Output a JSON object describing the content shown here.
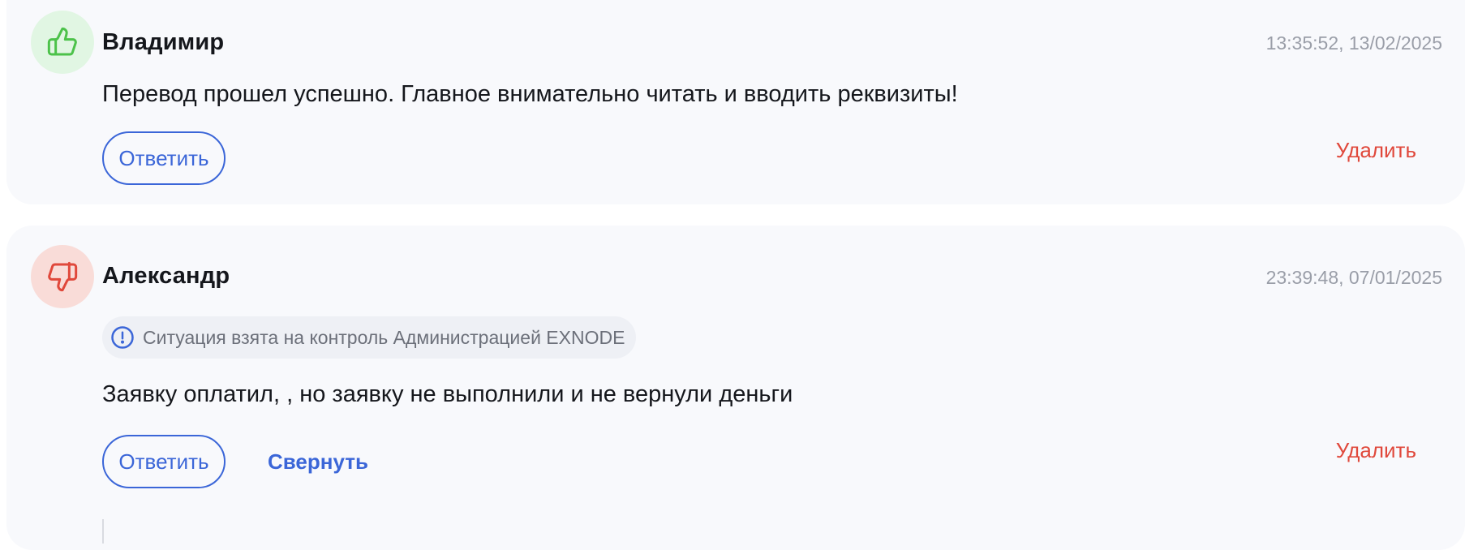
{
  "reviews": [
    {
      "sentiment": "positive",
      "avatar_icon": "thumbs-up-icon",
      "author": "Владимир",
      "timestamp": "13:35:52, 13/02/2025",
      "text": "Перевод прошел успешно. Главное внимательно читать и вводить реквизиты!",
      "reply_label": "Ответить",
      "delete_label": "Удалить"
    },
    {
      "sentiment": "negative",
      "avatar_icon": "thumbs-down-icon",
      "author": "Александр",
      "timestamp": "23:39:48, 07/01/2025",
      "notice": "Ситуация взята на контроль Администрацией EXNODE",
      "notice_icon": "info-icon",
      "text": "Заявку оплатил, , но заявку не выполнили и не вернули деньги",
      "reply_label": "Ответить",
      "collapse_label": "Свернуть",
      "delete_label": "Удалить"
    }
  ],
  "colors": {
    "accent": "#3b66d8",
    "danger": "#e0483b",
    "positive": "#4cc24a",
    "negative": "#e0483b",
    "muted": "#9a9ea8"
  }
}
